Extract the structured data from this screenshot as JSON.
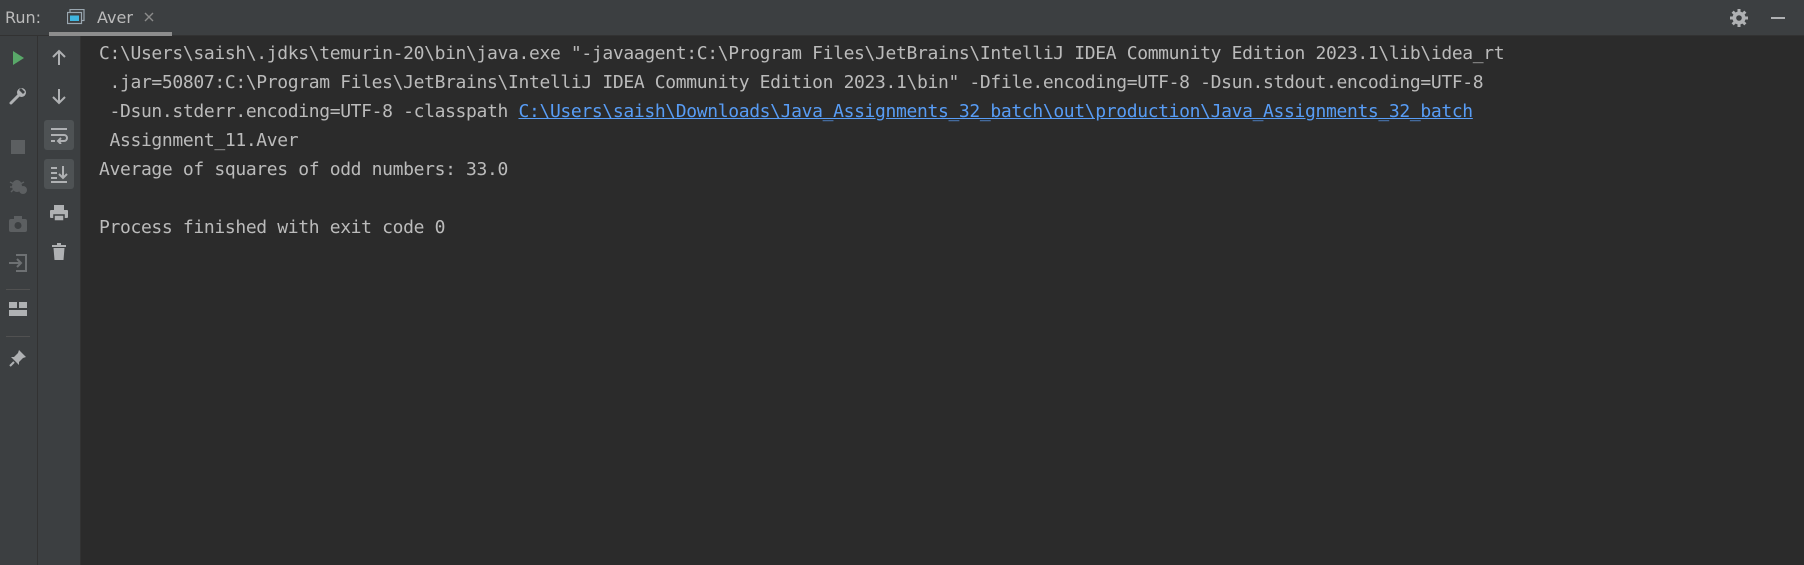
{
  "header": {
    "run_label": "Run:",
    "tab_title": "Aver"
  },
  "console": {
    "lines": [
      "C:\\Users\\saish\\.jdks\\temurin-20\\bin\\java.exe \"-javaagent:C:\\Program Files\\JetBrains\\IntelliJ IDEA Community Edition 2023.1\\lib\\idea_rt",
      " .jar=50807:C:\\Program Files\\JetBrains\\IntelliJ IDEA Community Edition 2023.1\\bin\" -Dfile.encoding=UTF-8 -Dsun.stdout.encoding=UTF-8",
      " -Dsun.stderr.encoding=UTF-8 -classpath ",
      " Assignment_11.Aver",
      "Average of squares of odd numbers: 33.0",
      "Process finished with exit code 0"
    ],
    "classpath_link": "C:\\Users\\saish\\Downloads\\Java_Assignments_32_batch\\out\\production\\Java_Assignments_32_batch"
  },
  "colors": {
    "background": "#2b2b2b",
    "panel": "#3c3f41",
    "text": "#bbbbbb",
    "link": "#589df6",
    "run_green": "#59a869"
  }
}
